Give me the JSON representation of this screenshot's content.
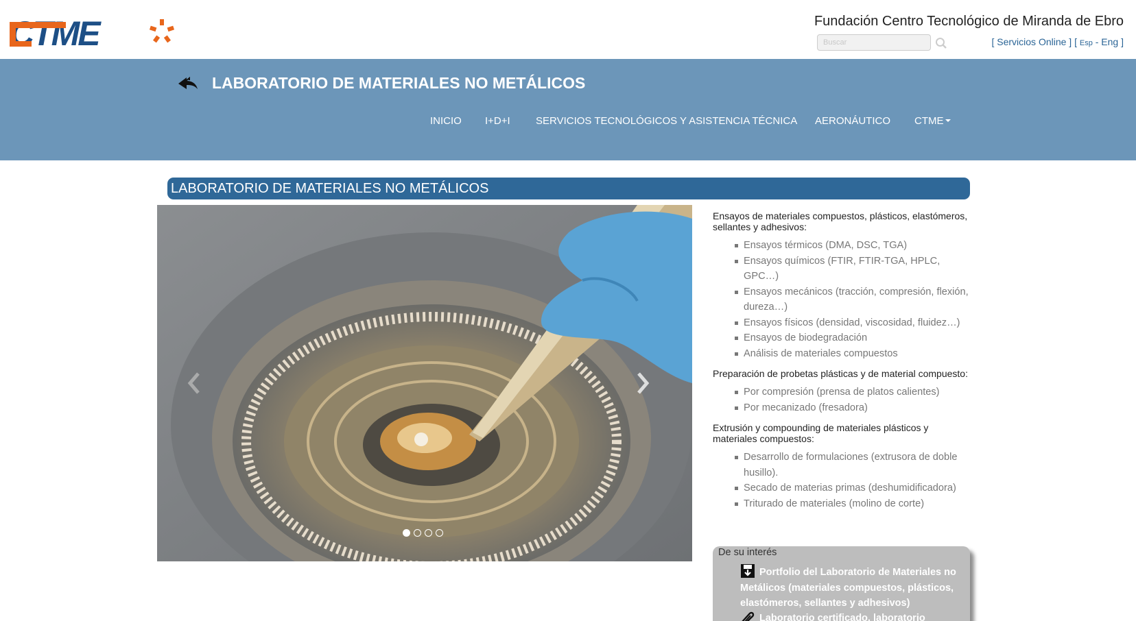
{
  "header": {
    "logo_text": "CTME",
    "org_title": "Fundación Centro Tecnológico de Miranda de Ebro",
    "search_placeholder": "Buscar",
    "links": {
      "open_bracket": "[ ",
      "servicios_online": "Servicios Online",
      "mid_bracket": " ] [ ",
      "esp": "Esp",
      "separator": " - ",
      "eng": "Eng",
      "close_bracket": " ]"
    }
  },
  "nav": {
    "section_title": "LABORATORIO DE MATERIALES NO METÁLICOS",
    "items": [
      {
        "label": "INICIO"
      },
      {
        "label": "I+D+I"
      },
      {
        "label": "SERVICIOS TECNOLÓGICOS Y ASISTENCIA TÉCNICA"
      },
      {
        "label": "AERONÁUTICO"
      },
      {
        "label": "CTME"
      }
    ]
  },
  "page": {
    "heading": "LABORATORIO DE MATERIALES NO METÁLICOS"
  },
  "carousel": {
    "slide_count": 4,
    "active_index": 0
  },
  "content": {
    "sections": [
      {
        "title": "Ensayos de materiales compuestos, plásticos, elastómeros, sellantes y adhesivos:",
        "items": [
          "Ensayos térmicos (DMA, DSC, TGA)",
          "Ensayos químicos (FTIR, FTIR-TGA, HPLC, GPC…)",
          "Ensayos mecánicos (tracción, compresión, flexión, dureza…)",
          "Ensayos físicos (densidad, viscosidad, fluidez…)",
          "Ensayos de biodegradación",
          "Análisis de materiales compuestos"
        ]
      },
      {
        "title": "Preparación de probetas plásticas y de material compuesto:",
        "items": [
          "Por compresión (prensa de platos calientes)",
          "Por mecanizado (fresadora)"
        ]
      },
      {
        "title": "Extrusión y compounding de materiales plásticos y materiales compuestos:",
        "items": [
          "Desarrollo de formulaciones (extrusora de doble husillo).",
          "Secado de materias primas (deshumidificadora)",
          "Triturado de materiales (molino de corte)"
        ]
      }
    ]
  },
  "interest": {
    "title": "De su interés",
    "items": [
      {
        "label": "Portfolio del Laboratorio de Materiales no Metálicos (materiales compuestos, plásticos, elastómeros, sellantes y adhesivos)",
        "icon": "download-icon"
      },
      {
        "label": "Laboratorio certificado, laboratorio",
        "icon": "paperclip-icon"
      }
    ]
  },
  "colors": {
    "nav_band": "#6c96b9",
    "heading_bar": "#2f6898",
    "logo_orange": "#e8661c",
    "logo_blue": "#1d4f86",
    "link": "#2a6496"
  }
}
